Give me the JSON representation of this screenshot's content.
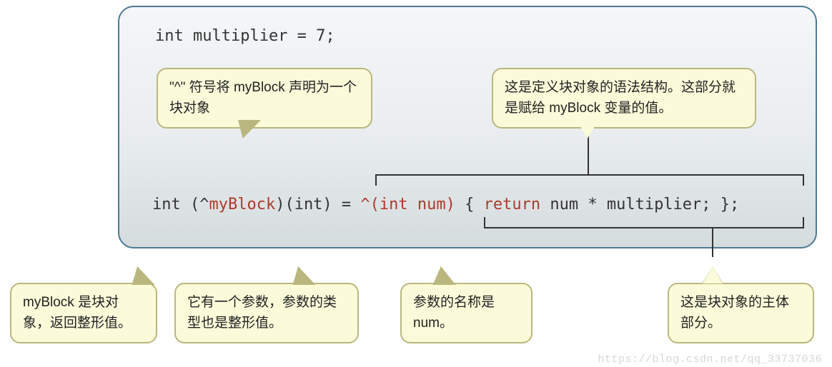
{
  "code": {
    "line1": "int multiplier = 7;",
    "line2_parts": {
      "t1": "int (^",
      "name": "myBlock",
      "t2": ")(int) = ",
      "caret": "^",
      "params": "(int num)",
      "t3": " { ",
      "ret": "return",
      "t4": " num * multiplier; };"
    }
  },
  "callouts": {
    "caret": "\"^\" 符号将 myBlock 声明为一个块对象",
    "syntax": "这是定义块对象的语法结构。这部分就是赋给 myBlock 变量的值。",
    "retType": "myBlock 是块对象，返回整形值。",
    "paramType": "它有一个参数，参数的类型也是整形值。",
    "paramName": "参数的名称是 num。",
    "body": "这是块对象的主体部分。"
  },
  "watermark": "https://blog.csdn.net/qq_33737036"
}
